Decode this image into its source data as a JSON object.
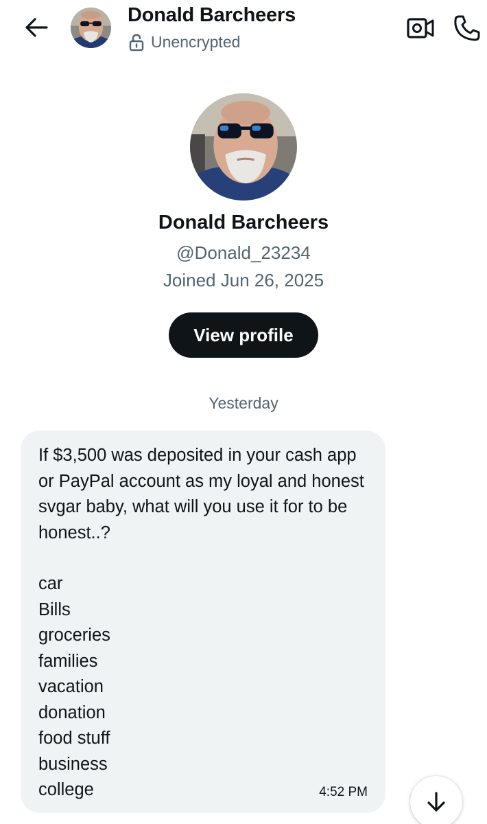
{
  "header": {
    "back_icon": "arrow-left-icon",
    "name": "Donald Barcheers",
    "encryption_icon": "unlocked-padlock-icon",
    "encryption_status": "Unencrypted",
    "video_icon": "video-camera-icon",
    "call_icon": "phone-icon"
  },
  "profile": {
    "name": "Donald Barcheers",
    "handle": "@Donald_23234",
    "joined": "Joined Jun 26, 2025",
    "view_profile_label": "View profile"
  },
  "conversation": {
    "date_separator": "Yesterday",
    "message": {
      "text": "If $3,500 was deposited in your cash app or PayPal account as my loyal and honest svgar baby, what will you use it for to be honest..?",
      "options": [
        "car",
        "Bills",
        "groceries",
        "families",
        "vacation",
        "donation",
        "food stuff",
        "business",
        "college"
      ],
      "time": "4:52 PM"
    },
    "scroll_icon": "arrow-down-icon"
  },
  "colors": {
    "text_primary": "#0f1419",
    "text_secondary": "#536471",
    "bubble_background": "#eff3f4",
    "button_background": "#0f1419"
  }
}
